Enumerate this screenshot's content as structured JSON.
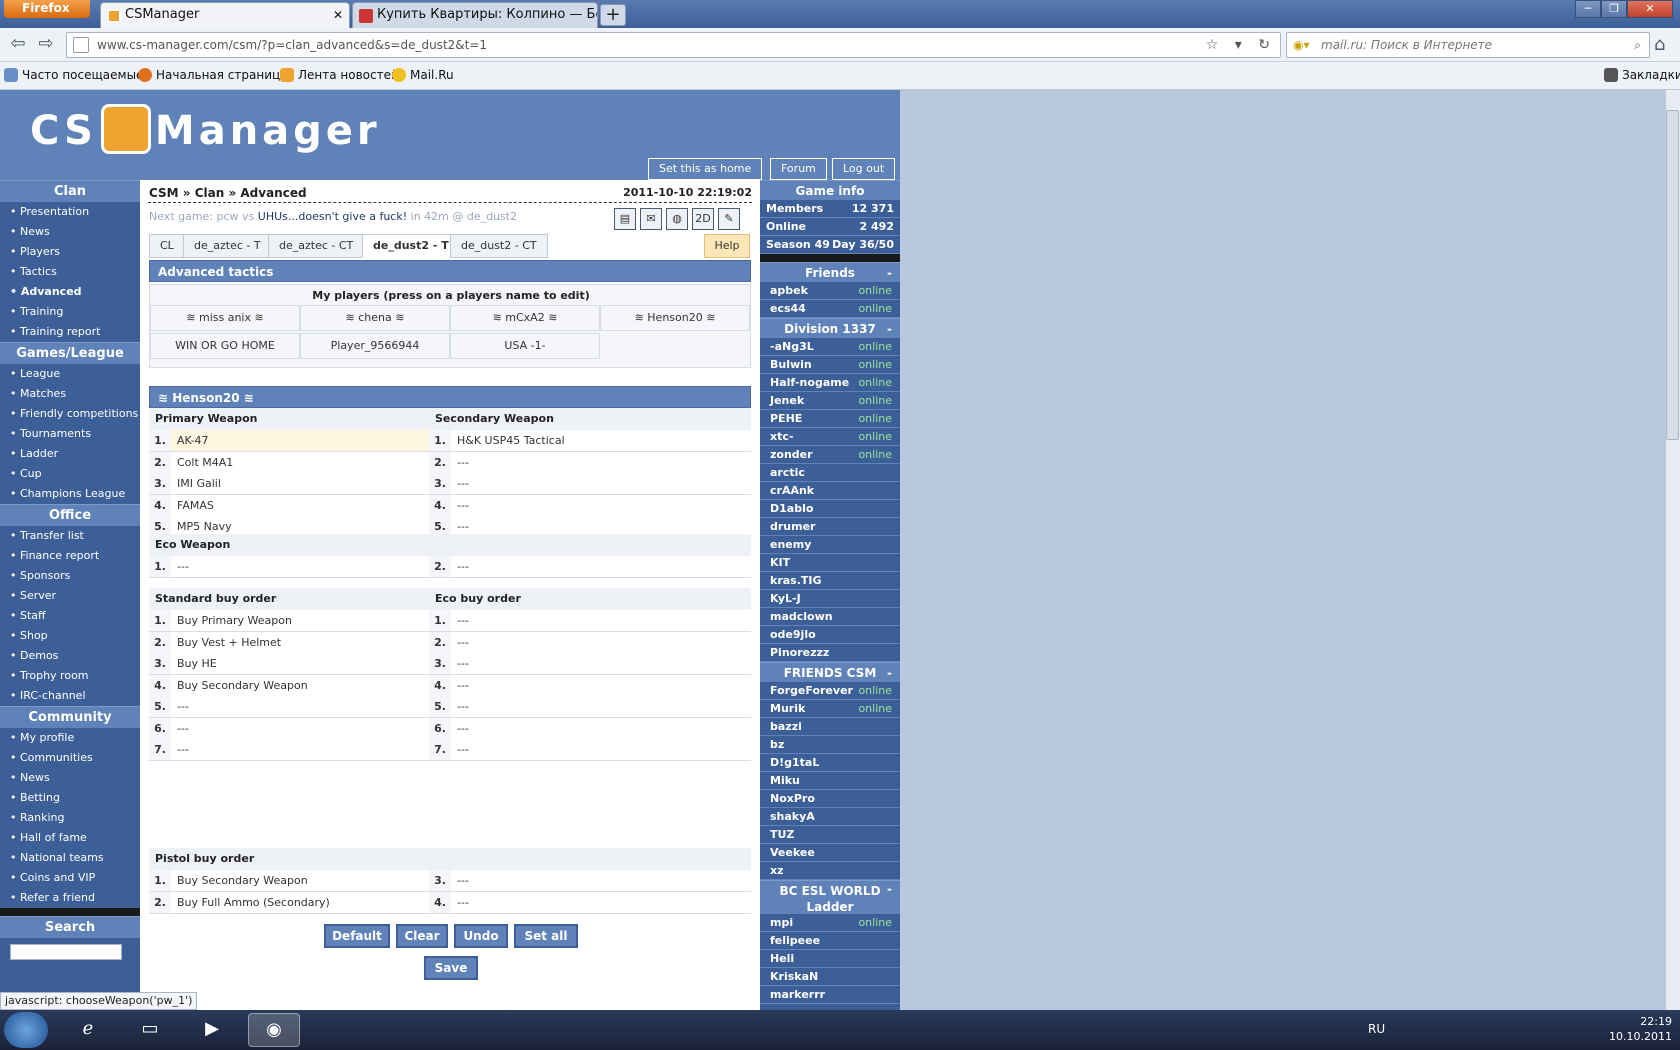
{
  "browser": {
    "menu_label": "Firefox",
    "tabs": [
      {
        "label": "CSManager"
      },
      {
        "label": "Купить Квартиры: Колпино — Бесп..."
      }
    ],
    "new_tab": "+",
    "url": "www.cs-manager.com/csm/?p=clan_advanced&s=de_dust2&t=1",
    "search_placeholder": "mail.ru: Поиск в Интернете",
    "bookmarks": [
      "Часто посещаемые",
      "Начальная страница",
      "Лента новостей",
      "Mail.Ru"
    ],
    "bookmarks_menu": "Закладки"
  },
  "site": {
    "logo": "CS",
    "logo2": "Manager",
    "header_buttons": [
      "Set this as home",
      "Forum",
      "Log out"
    ]
  },
  "leftnav": {
    "clan_title": "Clan",
    "clan": [
      "• Presentation",
      "• News",
      "• Players",
      "• Tactics",
      "• Advanced",
      "• Training",
      "• Training report"
    ],
    "games_title": "Games/League",
    "games": [
      "• League",
      "• Matches",
      "• Friendly competitions",
      "• Tournaments",
      "• Ladder",
      "• Cup",
      "• Champions League"
    ],
    "office_title": "Office",
    "office": [
      "• Transfer list",
      "• Finance report",
      "• Sponsors",
      "• Server",
      "• Staff",
      "• Shop",
      "• Demos",
      "• Trophy room",
      "• IRC-channel"
    ],
    "community_title": "Community",
    "community": [
      "• My profile",
      "• Communities",
      "• News",
      "• Betting",
      "• Ranking",
      "• Hall of fame",
      "• National teams",
      "• Coins and VIP",
      "• Refer a friend"
    ],
    "search_title": "Search"
  },
  "main": {
    "breadcrumb": "CSM » Clan » Advanced",
    "datetime": "2011-10-10 22:19:02",
    "next_game_prefix": "Next game: pcw vs",
    "next_game_team": "UHUs...doesn't give a fuck!",
    "next_game_suffix": "in 42m @ de_dust2",
    "icons": [
      "book-icon",
      "mail-icon",
      "pill-icon",
      "2D",
      "edit-icon"
    ],
    "icon_2d": "2D",
    "tabs": [
      "CL",
      "de_aztec - T",
      "de_aztec - CT",
      "de_dust2 - T",
      "de_dust2 - CT"
    ],
    "help": "Help",
    "adv_title": "Advanced tactics",
    "my_players_title": "My players (press on a players name to edit)",
    "players": [
      "≋ miss anix ≋",
      "≋ chena ≋",
      "≋ mCxA2 ≋",
      "≋ Henson20 ≋",
      "WIN OR GO HOME",
      "Player_9566944",
      "USA -1-"
    ],
    "selected_player": "≋ Henson20 ≋",
    "primary_title": "Primary Weapon",
    "secondary_title": "Secondary Weapon",
    "primary": [
      "AK-47",
      "Colt M4A1",
      "IMI Galil",
      "FAMAS",
      "MP5 Navy"
    ],
    "secondary": [
      "H&K USP45 Tactical",
      "---",
      "---",
      "---",
      "---"
    ],
    "eco_title": "Eco Weapon",
    "eco": [
      "---",
      "---"
    ],
    "std_buy_title": "Standard buy order",
    "eco_buy_title": "Eco buy order",
    "std_buy": [
      "Buy Primary Weapon",
      "Buy Vest + Helmet",
      "Buy HE",
      "Buy Secondary Weapon",
      "---",
      "---",
      "---"
    ],
    "eco_buy": [
      "---",
      "---",
      "---",
      "---",
      "---",
      "---",
      "---"
    ],
    "pistol_title": "Pistol buy order",
    "pistol_left": [
      "Buy Secondary Weapon",
      "Buy Full Ammo (Secondary)"
    ],
    "pistol_right": [
      "---",
      "---"
    ],
    "buttons": [
      "Default",
      "Clear",
      "Undo",
      "Set all"
    ],
    "save": "Save"
  },
  "right": {
    "game_info": "Game info",
    "members_label": "Members",
    "members": "12 371",
    "online_label": "Online",
    "online": "2 492",
    "season": "Season 49",
    "day": "Day 36/50",
    "friends_title": "Friends",
    "friends": [
      {
        "n": "apbek",
        "o": "online"
      },
      {
        "n": "ecs44",
        "o": "online"
      }
    ],
    "division_title": "Division 1337",
    "division": [
      {
        "n": "-aNg3L",
        "o": "online"
      },
      {
        "n": "Bulwin",
        "o": "online"
      },
      {
        "n": "Half-nogame",
        "o": "online"
      },
      {
        "n": "Jenek",
        "o": "online"
      },
      {
        "n": "PEHE",
        "o": "online"
      },
      {
        "n": "xtc-",
        "o": "online"
      },
      {
        "n": "zonder",
        "o": "online"
      },
      {
        "n": "arctic",
        "o": ""
      },
      {
        "n": "crAAnk",
        "o": ""
      },
      {
        "n": "D1ablo",
        "o": ""
      },
      {
        "n": "drumer",
        "o": ""
      },
      {
        "n": "enemy",
        "o": ""
      },
      {
        "n": "KIT",
        "o": ""
      },
      {
        "n": "kras.TIG",
        "o": ""
      },
      {
        "n": "KyL-J",
        "o": ""
      },
      {
        "n": "madclown",
        "o": ""
      },
      {
        "n": "ode9jlo",
        "o": ""
      },
      {
        "n": "Pinorezzz",
        "o": ""
      }
    ],
    "friends_csm_title": "FRIENDS CSM",
    "friends_csm": [
      {
        "n": "ForgeForever",
        "o": "online"
      },
      {
        "n": "Murik",
        "o": "online"
      },
      {
        "n": "bazzi",
        "o": ""
      },
      {
        "n": "bz",
        "o": ""
      },
      {
        "n": "D!g1taL",
        "o": ""
      },
      {
        "n": "Miku",
        "o": ""
      },
      {
        "n": "NoxPro",
        "o": ""
      },
      {
        "n": "shakyA",
        "o": ""
      },
      {
        "n": "TUZ",
        "o": ""
      },
      {
        "n": "Veekee",
        "o": ""
      },
      {
        "n": "xz",
        "o": ""
      }
    ],
    "esl_title": "BC ESL WORLD Ladder",
    "esl": [
      {
        "n": "mpi",
        "o": "online"
      },
      {
        "n": "felipeee",
        "o": ""
      },
      {
        "n": "Heli",
        "o": ""
      },
      {
        "n": "KriskaN",
        "o": ""
      },
      {
        "n": "markerrr",
        "o": ""
      }
    ],
    "collapse": "-"
  },
  "status": "javascript: chooseWeapon('pw_1')",
  "taskbar": {
    "lang": "RU",
    "time": "22:19",
    "date": "10.10.2011"
  }
}
